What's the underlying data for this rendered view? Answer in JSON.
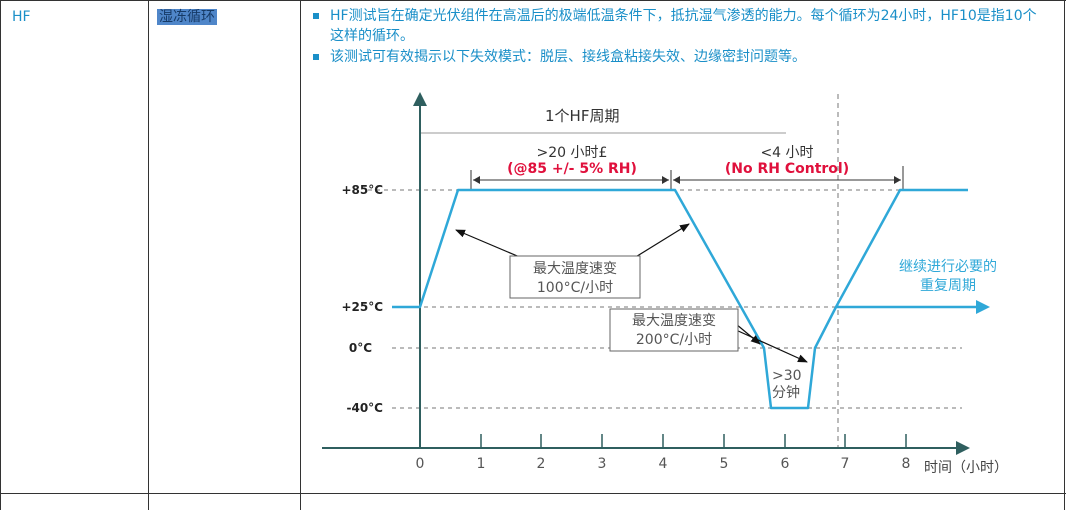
{
  "table": {
    "code": "HF",
    "name": "湿冻循环",
    "bullets": [
      "HF测试旨在确定光伏组件在高温后的极端低温条件下，抵抗湿气渗透的能力。每个循环为24小时，HF10是指10个这样的循环。",
      "该测试可有效揭示以下失效模式：脱层、接线盒粘接失效、边缘密封问题等。"
    ]
  },
  "diagram": {
    "cycle_label": "1个HF周期",
    "phase1_time": ">20 小时£",
    "phase1_cond": "(@85 +/- 5% RH)",
    "phase2_time": "<4 小时",
    "phase2_cond": "(No RH Control)",
    "temps": [
      "+85°C",
      "+25°C",
      "0°C",
      "-40°C"
    ],
    "ramp1_line1": "最大温度速变",
    "ramp1_line2": "100°C/小时",
    "ramp2_line1": "最大温度速变",
    "ramp2_line2": "200°C/小时",
    "dwell_line1": ">30",
    "dwell_line2": "分钟",
    "continue_line1": "继续进行必要的",
    "continue_line2": "重复周期",
    "x_ticks": [
      "0",
      "1",
      "2",
      "3",
      "4",
      "5",
      "6",
      "7",
      "8"
    ],
    "x_label": "时间（小时）",
    "colors": {
      "profile": "#2fa8d8",
      "condition_red": "#e0103c",
      "axis": "#2f5f5f",
      "text": "#333333",
      "ticks": "#555555"
    }
  }
}
